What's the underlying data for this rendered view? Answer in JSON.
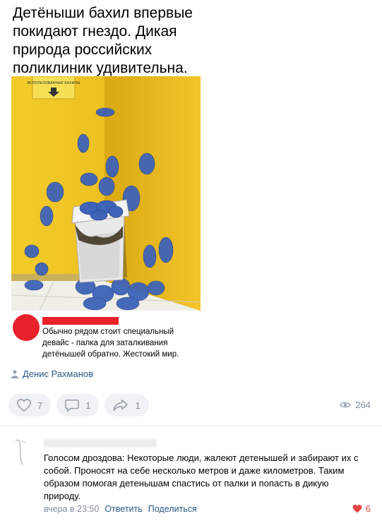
{
  "meme": {
    "title": "Детёныши бахил впервые покидают гнездо. Дикая природа российских поликлиник удивительна.",
    "photo_sign": "ИСПОЛЬЗОВАННЫЕ БАХИЛЫ",
    "caption": "Обычно рядом стоит специальный девайс - палка для заталкивания детёнышей обратно. Жестокий мир."
  },
  "post": {
    "author": "Денис Рахманов",
    "likes": "7",
    "comments": "1",
    "shares": "1",
    "views": "264"
  },
  "comment": {
    "text": "Голосом дроздова: Некоторые люди, жалеют детенышей и забирают их с собой. Проносят на себе несколько метров и даже километров. Таким образом помогая детенышам спастись от палки и попасть в дикую природу.",
    "time": "вчера в 23:50",
    "reply_label": "Ответить",
    "share_label": "Поделиться",
    "likes": "6"
  },
  "colors": {
    "wall": "#eec21f",
    "link": "#2a5885",
    "muted": "#818c99",
    "heart": "#e64646",
    "redacted": "#e8212a"
  }
}
